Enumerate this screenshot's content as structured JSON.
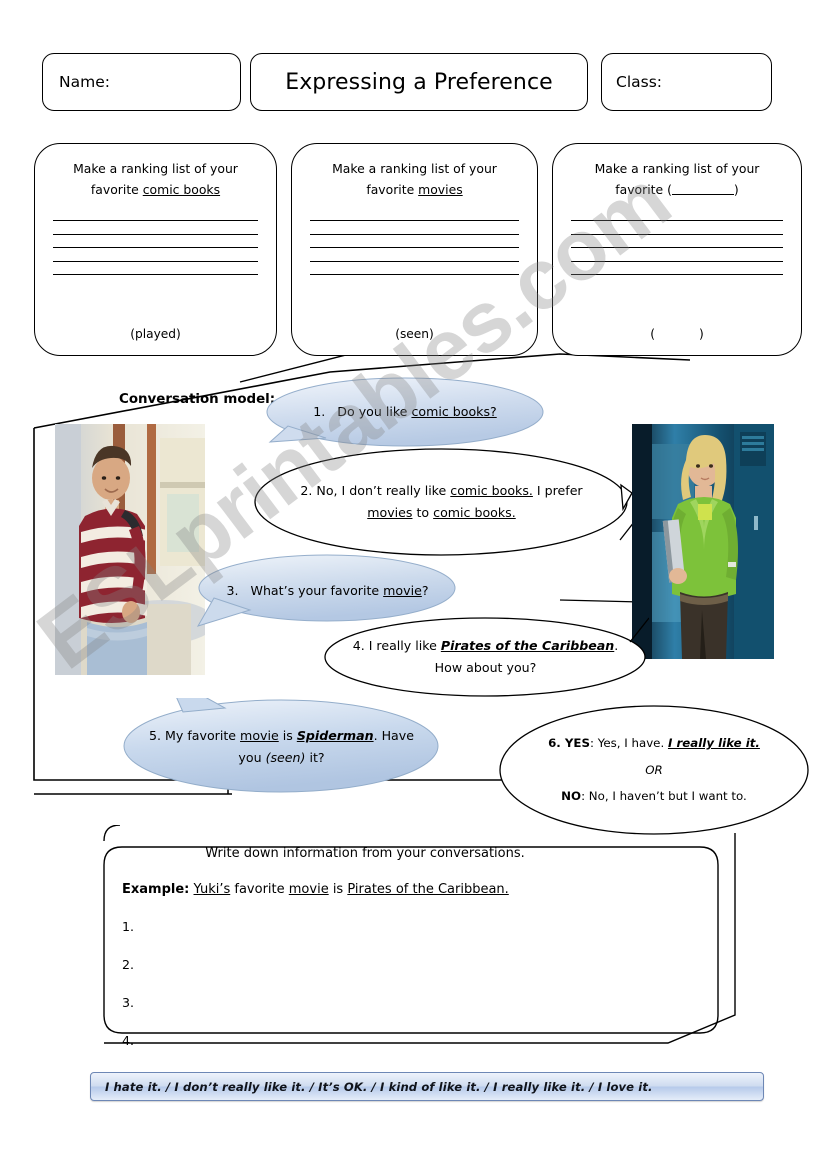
{
  "header": {
    "name_label": "Name:",
    "title": "Expressing a Preference",
    "class_label": "Class:"
  },
  "ranking_boxes": [
    {
      "prompt_line1": "Make a ranking list of your",
      "prompt_line2_prefix": "favorite ",
      "prompt_line2_underlined": "comic books",
      "has_blank": false,
      "line_count": 5,
      "footer": "(played)"
    },
    {
      "prompt_line1": "Make a ranking list of your",
      "prompt_line2_prefix": "favorite ",
      "prompt_line2_underlined": "movies",
      "has_blank": false,
      "line_count": 5,
      "footer": "(seen)"
    },
    {
      "prompt_line1": "Make a ranking list of your",
      "prompt_line2_prefix": "favorite ",
      "prompt_line2_underlined": "",
      "has_blank": true,
      "blank_open": "(",
      "blank_close": ")",
      "line_count": 5,
      "footer_open": "(",
      "footer_close": ")"
    }
  ],
  "conversation": {
    "label": "Conversation model:",
    "bubbles": [
      {
        "id": "bubble1",
        "number": "1.",
        "style": "blue",
        "text_plain": "1.   Do you like comic books?",
        "parts": [
          {
            "t": "1.   Do you like ",
            "s": "plain"
          },
          {
            "t": "comic books?",
            "s": "u"
          }
        ]
      },
      {
        "id": "bubble2",
        "number": "2.",
        "style": "white",
        "text_plain": "2.  No, I don't really like comic books.  I prefer movies to comic books.",
        "parts": [
          {
            "t": "2.  No, I don’t really like ",
            "s": "plain"
          },
          {
            "t": "comic books.",
            "s": "u"
          },
          {
            "t": "  I prefer ",
            "s": "plain"
          },
          {
            "t": "movies",
            "s": "u"
          },
          {
            "t": " to ",
            "s": "plain"
          },
          {
            "t": "comic books.",
            "s": "u"
          }
        ]
      },
      {
        "id": "bubble3",
        "number": "3.",
        "style": "blue",
        "text_plain": "3.  What's your favorite movie?",
        "parts": [
          {
            "t": "3.   What’s your favorite ",
            "s": "plain"
          },
          {
            "t": "movie",
            "s": "u"
          },
          {
            "t": "?",
            "s": "plain"
          }
        ]
      },
      {
        "id": "bubble4",
        "number": "4.",
        "style": "white",
        "text_plain": "4.  I really like Pirates of the Caribbean.  How about you?",
        "parts": [
          {
            "t": "4.  I really like ",
            "s": "plain"
          },
          {
            "t": "Pirates of the Caribbean",
            "s": "bui"
          },
          {
            "t": ".  How about you?",
            "s": "plain"
          }
        ]
      },
      {
        "id": "bubble5",
        "number": "5.",
        "style": "blue",
        "text_plain": "5.  My favorite movie is Spiderman.  Have you (seen) it?",
        "parts": [
          {
            "t": "5.  My favorite ",
            "s": "plain"
          },
          {
            "t": "movie",
            "s": "u"
          },
          {
            "t": " is ",
            "s": "plain"
          },
          {
            "t": "Spiderman",
            "s": "bui"
          },
          {
            "t": ".  Have you ",
            "s": "plain"
          },
          {
            "t": "(seen)",
            "s": "i"
          },
          {
            "t": " it?",
            "s": "plain"
          }
        ]
      },
      {
        "id": "bubble6",
        "number": "6.",
        "style": "white",
        "text_plain": "6. YES:  Yes, I have.  I really like it.   OR   NO:  No, I haven't but I want to.",
        "yes_label": "6. YES",
        "yes_text": ":  Yes, I have.  ",
        "yes_emphasis": "I really like it.",
        "or_text": "OR",
        "no_label": "NO",
        "no_text": ":  No, I haven’t but I want to."
      }
    ]
  },
  "write_section": {
    "title": "Write down information from your conversations.",
    "example_label": "Example:",
    "example_parts": [
      {
        "t": "Yuki’s",
        "s": "u"
      },
      {
        "t": " favorite ",
        "s": "plain"
      },
      {
        "t": "movie",
        "s": "u"
      },
      {
        "t": " is ",
        "s": "plain"
      },
      {
        "t": "Pirates of the Caribbean.",
        "s": "u"
      }
    ],
    "items": [
      "1.",
      "2.",
      "3.",
      "4."
    ]
  },
  "scale_strip": {
    "text": "I hate it.   /    I don’t really like it.   /   It’s OK.   /   I kind of like it. /   I really like it.  /     I love it.",
    "options": [
      "I hate it.",
      "I don’t really like it.",
      "It’s OK.",
      "I kind of like it.",
      "I really like it.",
      "I love it."
    ],
    "separator": "/"
  },
  "watermark": {
    "text": "ESLprintables.com"
  },
  "photos": {
    "left": {
      "alt": "teenage boy in maroon and white striped polo shirt leaning on wall in school hallway",
      "colors": {
        "shirt": "#8e2430",
        "stripe": "#f3ece1",
        "skin": "#d8a883",
        "hair": "#4a3626",
        "wall": "#cfd5da",
        "window": "#e9e2cf"
      }
    },
    "right": {
      "alt": "teenage girl with blonde hair in a bright green jacket standing by blue lockers",
      "colors": {
        "jacket": "#7dc23a",
        "hair": "#e0c97c",
        "skin": "#e2b896",
        "locker": "#1e5f86",
        "pants": "#3a3229",
        "dark": "#0b2230"
      }
    }
  }
}
